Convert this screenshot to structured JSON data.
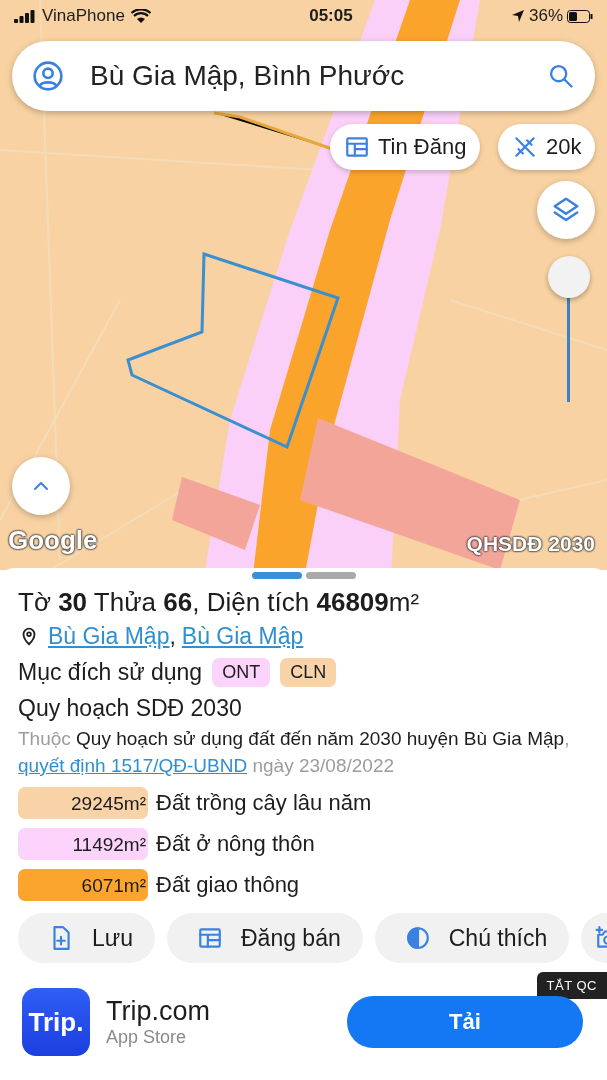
{
  "status_bar": {
    "carrier": "VinaPhone",
    "time": "05:05",
    "battery": "36%"
  },
  "search": {
    "value": "Bù Gia Mập, Bình Phước"
  },
  "map_controls": {
    "listings_button": "Tin Đăng",
    "scale_button": "20k",
    "opacity_slider": {
      "level": 1
    }
  },
  "map_labels": {
    "brand": "Google",
    "layer": "QHSDĐ 2030"
  },
  "sheet": {
    "pages": [
      {
        "selected": true
      },
      {
        "selected": false
      }
    ],
    "title": "Tờ **30** Thửa **66**, Diện tích **46809**m²",
    "location_links": [
      "Bù Gia Mập",
      "Bù Gia Mập"
    ],
    "location_separator": ",",
    "purpose_label": "Mục đích sử dụng",
    "purpose_tags": [
      {
        "label": "ONT",
        "color": "#fbd3fb"
      },
      {
        "label": "CLN",
        "color": "#f9d3a8"
      }
    ],
    "plan_title": "Quy hoạch SDĐ 2030",
    "description": {
      "prefix": "Thuộc",
      "text": "Quy hoạch sử dụng đất đến năm 2030 huyện Bù Gia Mập",
      "separator": ",",
      "link": "quyết định 1517/QĐ-UBND",
      "suffix": "ngày 23/08/2022"
    },
    "land_areas": [
      {
        "area": "29245m²",
        "name": "Đất trồng cây lâu năm",
        "color": "#f9d3a8"
      },
      {
        "area": "11492m²",
        "name": "Đất ở nông thôn",
        "color": "#fbd3fb"
      },
      {
        "area": "6071m²",
        "name": "Đất giao thông",
        "color": "#fca52e"
      }
    ],
    "actions": [
      {
        "kind": "save",
        "label": "Lưu"
      },
      {
        "kind": "sell",
        "label": "Đăng bán"
      },
      {
        "kind": "legend",
        "label": "Chú thích"
      },
      {
        "kind": "camera"
      }
    ]
  },
  "ad": {
    "close_label": "TẮT QC",
    "logo_text": "Trip.",
    "app_name": "Trip.com",
    "store": "App Store",
    "button": "Tải"
  }
}
